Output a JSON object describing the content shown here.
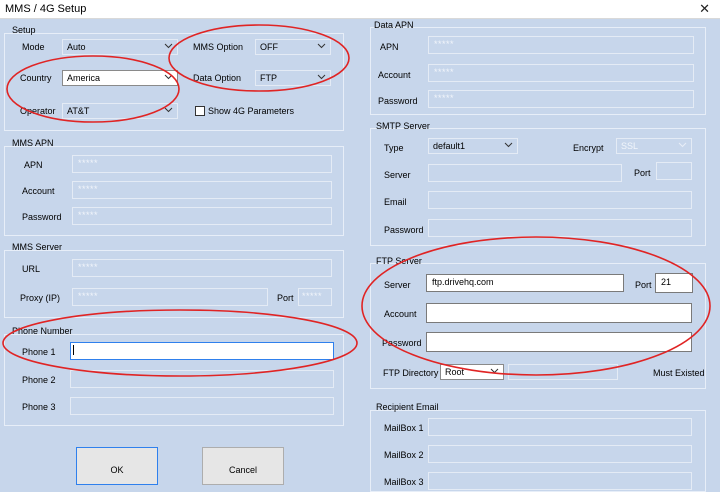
{
  "window": {
    "title": "MMS / 4G Setup",
    "close_glyph": "✕"
  },
  "setup": {
    "title": "Setup",
    "mode_label": "Mode",
    "mode_value": "Auto",
    "country_label": "Country",
    "country_value": "America",
    "operator_label": "Operator",
    "operator_value": "AT&T",
    "mms_option_label": "MMS Option",
    "mms_option_value": "OFF",
    "data_option_label": "Data Option",
    "data_option_value": "FTP",
    "show_4g_label": "Show 4G Parameters",
    "show_4g_checked": false
  },
  "mms_apn": {
    "title": "MMS APN",
    "apn_label": "APN",
    "apn_value": "*****",
    "account_label": "Account",
    "account_value": "*****",
    "password_label": "Password",
    "password_value": "*****"
  },
  "mms_server": {
    "title": "MMS Server",
    "url_label": "URL",
    "url_value": "*****",
    "proxy_label": "Proxy (IP)",
    "proxy_value": "*****",
    "port_label": "Port",
    "port_value": "*****"
  },
  "phone_number": {
    "title": "Phone Number",
    "phone1_label": "Phone 1",
    "phone1_value": "",
    "phone2_label": "Phone 2",
    "phone2_value": "",
    "phone3_label": "Phone 3",
    "phone3_value": ""
  },
  "buttons": {
    "ok_label": "OK",
    "cancel_label": "Cancel"
  },
  "data_apn": {
    "title": "Data APN",
    "apn_label": "APN",
    "apn_value": "*****",
    "account_label": "Account",
    "account_value": "*****",
    "password_label": "Password",
    "password_value": "*****"
  },
  "smtp_server": {
    "title": "SMTP Server",
    "type_label": "Type",
    "type_value": "default1",
    "encrypt_label": "Encrypt",
    "encrypt_value": "SSL",
    "server_label": "Server",
    "server_value": "",
    "port_label": "Port",
    "port_value": "",
    "email_label": "Email",
    "email_value": "",
    "password_label": "Password",
    "password_value": ""
  },
  "ftp_server": {
    "title": "FTP Server",
    "server_label": "Server",
    "server_value": "ftp.drivehq.com",
    "port_label": "Port",
    "port_value": "21",
    "account_label": "Account",
    "account_value": "",
    "password_label": "Password",
    "password_value": "",
    "directory_label": "FTP Directory",
    "directory_value": "Root",
    "must_existed_label": "Must Existed"
  },
  "recipient_email": {
    "title": "Recipient Email",
    "mailbox1_label": "MailBox 1",
    "mailbox2_label": "MailBox 2",
    "mailbox3_label": "MailBox 3"
  },
  "colors": {
    "background": "#c7d6eb",
    "highlight_ellipse": "#e02424",
    "focus_border": "#2f80ed"
  }
}
